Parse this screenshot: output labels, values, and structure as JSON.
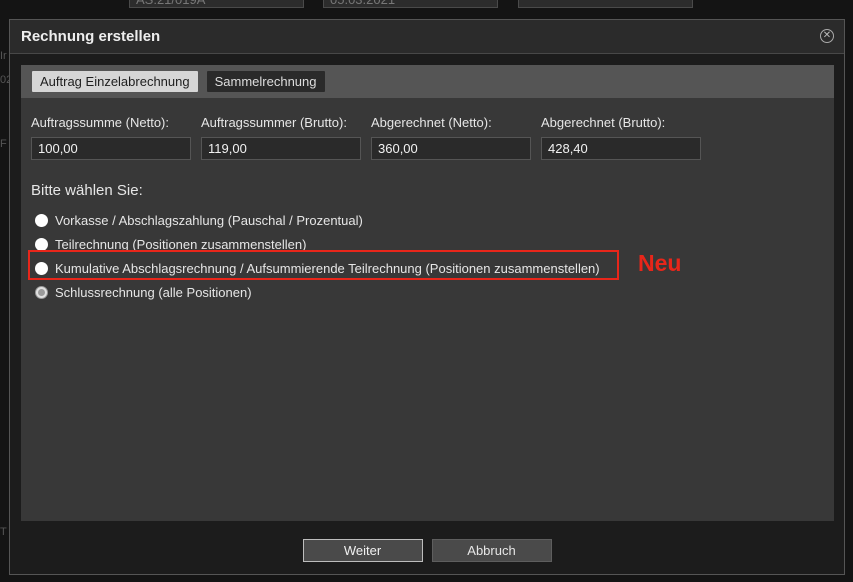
{
  "background": {
    "field1": "AS:21/019A",
    "field2": "05.03.2021",
    "field3": "",
    "left_fragments": [
      "Ir",
      "02",
      "F",
      "T"
    ]
  },
  "dialog": {
    "title": "Rechnung erstellen",
    "close_icon": "close-circle-icon",
    "tabs": [
      {
        "label": "Auftrag Einzelabrechnung",
        "active": true
      },
      {
        "label": "Sammelrechnung",
        "active": false
      }
    ],
    "sums": [
      {
        "label": "Auftragssumme (Netto):",
        "value": "100,00"
      },
      {
        "label": "Auftragssummer (Brutto):",
        "value": "119,00"
      },
      {
        "label": "Abgerechnet (Netto):",
        "value": "360,00"
      },
      {
        "label": "Abgerechnet (Brutto):",
        "value": "428,40"
      }
    ],
    "prompt": "Bitte wählen Sie:",
    "options": [
      {
        "label": "Vorkasse / Abschlagszahlung (Pauschal / Prozentual)",
        "checked": false
      },
      {
        "label": "Teilrechnung (Positionen zusammenstellen)",
        "checked": false
      },
      {
        "label": "Kumulative Abschlagsrechnung / Aufsummierende Teilrechnung (Positionen zusammenstellen)",
        "checked": false
      },
      {
        "label": "Schlussrechnung (alle Positionen)",
        "checked": true
      }
    ],
    "annotation": "Neu",
    "annotation_color": "#e8261a",
    "buttons": {
      "next": "Weiter",
      "cancel": "Abbruch"
    }
  }
}
